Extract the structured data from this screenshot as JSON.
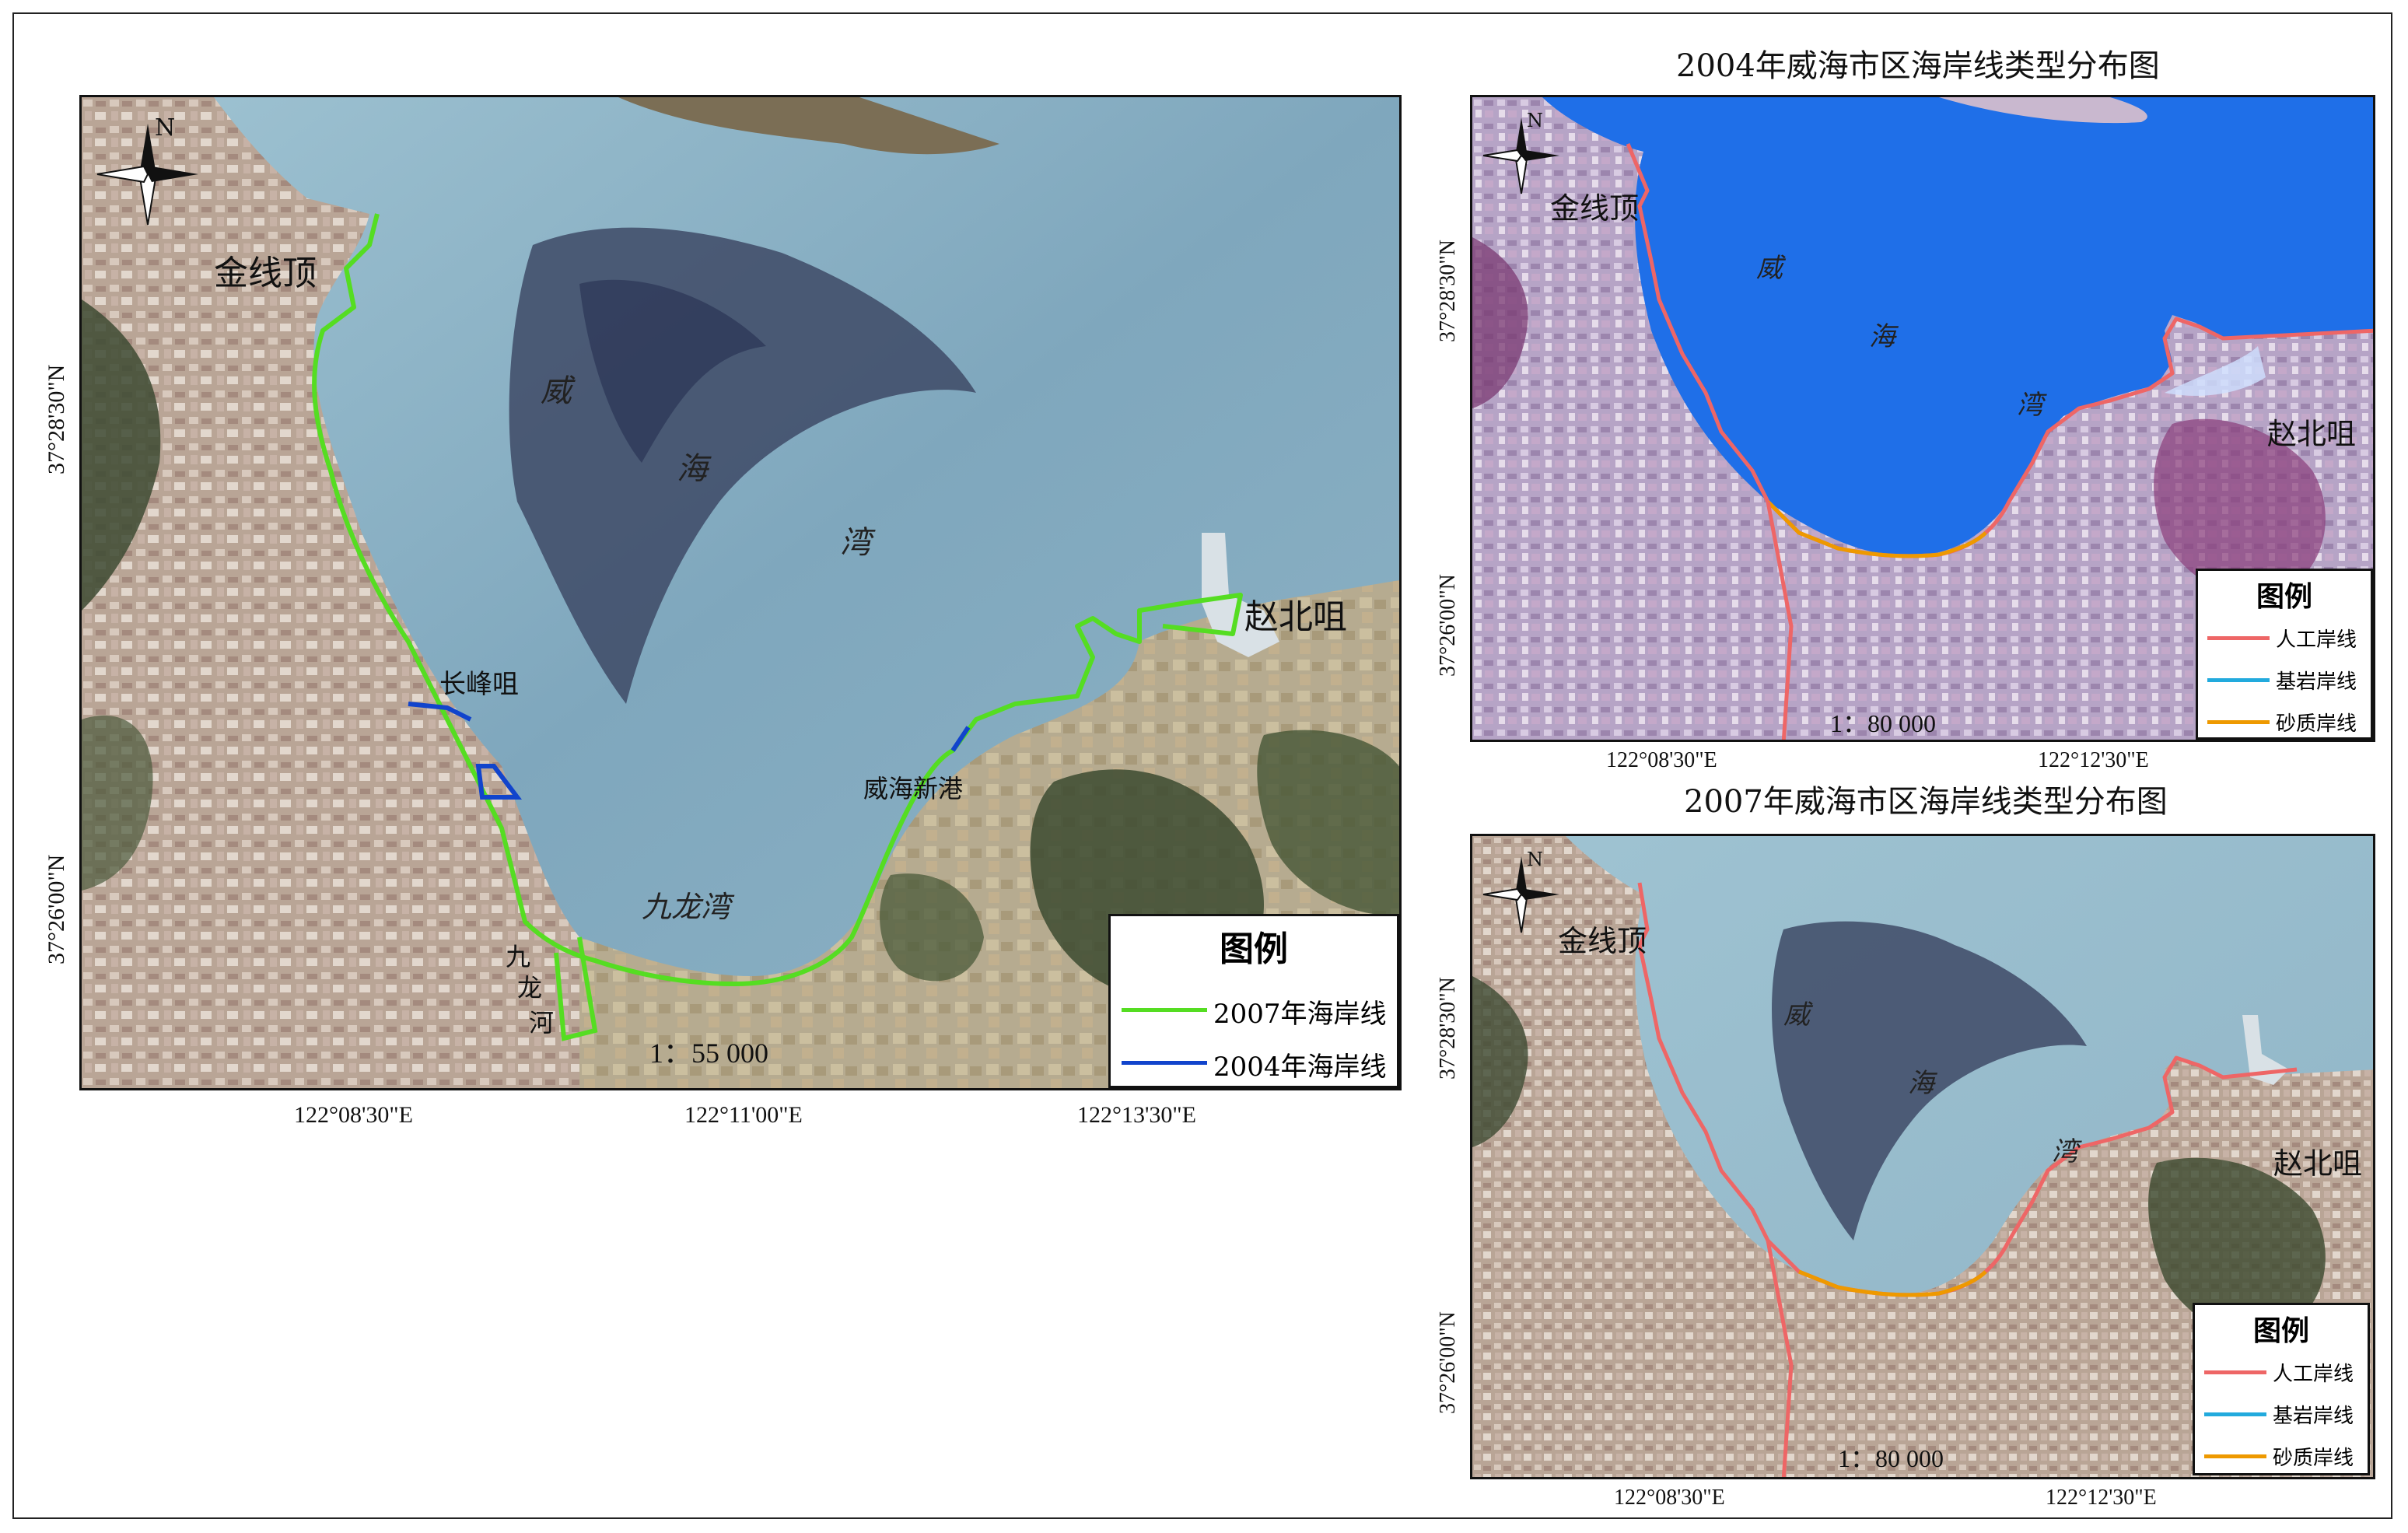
{
  "main_map": {
    "legend_title": "图例",
    "legend_items": [
      {
        "label": "2007年海岸线",
        "color": "#55dd22"
      },
      {
        "label": "2004年海岸线",
        "color": "#1144cc"
      }
    ],
    "scale": "1：55 000",
    "x_ticks": [
      "122°08'30\"E",
      "122°11'00\"E",
      "122°13'30\"E"
    ],
    "y_ticks": [
      "37°28'30\"N",
      "37°26'00\"N"
    ],
    "places": {
      "jinxianding": "金线顶",
      "zhaobeizui": "赵北咀",
      "changfengzui": "长峰咀",
      "weihaixingang": "威海新港",
      "jiulongwan": "九龙湾",
      "jiulonghe": [
        "九",
        "龙",
        "河"
      ],
      "bay_chars": [
        "威",
        "海",
        "湾"
      ]
    },
    "compass_n": "N"
  },
  "map_2004": {
    "title": "2004年威海市区海岸线类型分布图",
    "legend_title": "图例",
    "legend_items": [
      {
        "label": "人工岸线",
        "color": "#ee6666"
      },
      {
        "label": "基岩岸线",
        "color": "#22aadd"
      },
      {
        "label": "砂质岸线",
        "color": "#ee9900"
      }
    ],
    "scale": "1：80 000",
    "x_ticks": [
      "122°08'30\"E",
      "122°12'30\"E"
    ],
    "y_ticks": [
      "37°28'30\"N",
      "37°26'00\"N"
    ],
    "places": {
      "jinxianding": "金线顶",
      "zhaobeizui": "赵北咀",
      "bay_chars": [
        "威",
        "海",
        "湾"
      ]
    },
    "compass_n": "N"
  },
  "map_2007": {
    "title": "2007年威海市区海岸线类型分布图",
    "legend_title": "图例",
    "legend_items": [
      {
        "label": "人工岸线",
        "color": "#ee6666"
      },
      {
        "label": "基岩岸线",
        "color": "#22aadd"
      },
      {
        "label": "砂质岸线",
        "color": "#ee9900"
      }
    ],
    "scale": "1：80 000",
    "x_ticks": [
      "122°08'30\"E",
      "122°12'30\"E"
    ],
    "y_ticks": [
      "37°28'30\"N",
      "37°26'00\"N"
    ],
    "places": {
      "jinxianding": "金线顶",
      "zhaobeizui": "赵北咀",
      "bay_chars": [
        "威",
        "海",
        "湾"
      ]
    },
    "compass_n": "N"
  }
}
